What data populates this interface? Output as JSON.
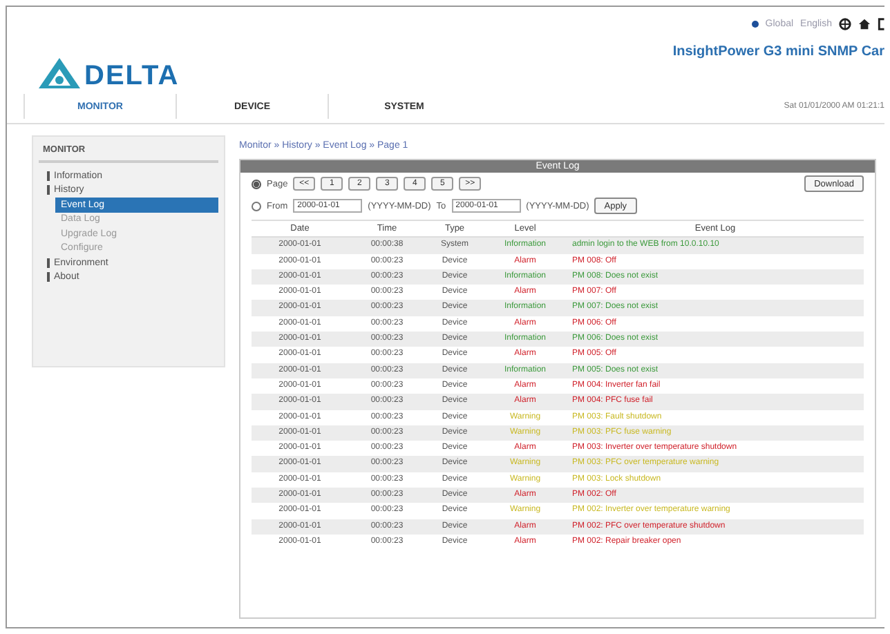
{
  "header": {
    "logo_text": "DELTA",
    "region": "Global",
    "language": "English",
    "product": "InsightPower G3 mini SNMP Car",
    "datetime": "Sat 01/01/2000 AM 01:21:1"
  },
  "nav": [
    {
      "label": "MONITOR",
      "selected": true
    },
    {
      "label": "DEVICE",
      "selected": false
    },
    {
      "label": "SYSTEM",
      "selected": false
    }
  ],
  "sidebar": {
    "title": "MONITOR",
    "items": [
      {
        "label": "Information",
        "selected": false
      },
      {
        "label": "History",
        "selected": false,
        "children": [
          {
            "label": "Event Log",
            "selected": true
          },
          {
            "label": "Data Log",
            "selected": false
          },
          {
            "label": "Upgrade Log",
            "selected": false
          },
          {
            "label": "Configure",
            "selected": false
          }
        ]
      },
      {
        "label": "Environment",
        "selected": false
      },
      {
        "label": "About",
        "selected": false
      }
    ]
  },
  "breadcrumb": "Monitor » History » Event Log » Page 1",
  "panel": {
    "title": "Event Log",
    "page_label": "Page",
    "page_selected": true,
    "range_selected": false,
    "pages": [
      "<<",
      "1",
      "2",
      "3",
      "4",
      "5",
      ">>"
    ],
    "download": "Download",
    "from_label": "From",
    "from_value": "2000-01-01",
    "from_hint": "(YYYY-MM-DD)",
    "to_label": "To",
    "to_value": "2000-01-01",
    "to_hint": "(YYYY-MM-DD)",
    "apply": "Apply"
  },
  "table": {
    "columns": [
      "Date",
      "Time",
      "Type",
      "Level",
      "Event Log"
    ],
    "rows": [
      {
        "date": "2000-01-01",
        "time": "00:00:38",
        "type": "System",
        "level": "Information",
        "event": "admin login to the WEB from 10.0.10.10",
        "color": "#3c9a3c"
      },
      {
        "date": "2000-01-01",
        "time": "00:00:23",
        "type": "Device",
        "level": "Alarm",
        "event": "PM 008: Off",
        "color": "#d0202a"
      },
      {
        "date": "2000-01-01",
        "time": "00:00:23",
        "type": "Device",
        "level": "Information",
        "event": "PM 008: Does not exist",
        "color": "#3c9a3c"
      },
      {
        "date": "2000-01-01",
        "time": "00:00:23",
        "type": "Device",
        "level": "Alarm",
        "event": "PM 007: Off",
        "color": "#d0202a"
      },
      {
        "date": "2000-01-01",
        "time": "00:00:23",
        "type": "Device",
        "level": "Information",
        "event": "PM 007: Does not exist",
        "color": "#3c9a3c"
      },
      {
        "date": "2000-01-01",
        "time": "00:00:23",
        "type": "Device",
        "level": "Alarm",
        "event": "PM 006: Off",
        "color": "#d0202a"
      },
      {
        "date": "2000-01-01",
        "time": "00:00:23",
        "type": "Device",
        "level": "Information",
        "event": "PM 006: Does not exist",
        "color": "#3c9a3c"
      },
      {
        "date": "2000-01-01",
        "time": "00:00:23",
        "type": "Device",
        "level": "Alarm",
        "event": "PM 005: Off",
        "color": "#d0202a"
      },
      {
        "date": "2000-01-01",
        "time": "00:00:23",
        "type": "Device",
        "level": "Information",
        "event": "PM 005: Does not exist",
        "color": "#3c9a3c"
      },
      {
        "date": "2000-01-01",
        "time": "00:00:23",
        "type": "Device",
        "level": "Alarm",
        "event": "PM 004: Inverter fan fail",
        "color": "#d0202a"
      },
      {
        "date": "2000-01-01",
        "time": "00:00:23",
        "type": "Device",
        "level": "Alarm",
        "event": "PM 004: PFC fuse fail",
        "color": "#d0202a"
      },
      {
        "date": "2000-01-01",
        "time": "00:00:23",
        "type": "Device",
        "level": "Warning",
        "event": "PM 003: Fault shutdown",
        "color": "#c8b820"
      },
      {
        "date": "2000-01-01",
        "time": "00:00:23",
        "type": "Device",
        "level": "Warning",
        "event": "PM 003: PFC fuse warning",
        "color": "#c8b820"
      },
      {
        "date": "2000-01-01",
        "time": "00:00:23",
        "type": "Device",
        "level": "Alarm",
        "event": "PM 003: Inverter over temperature shutdown",
        "color": "#d0202a"
      },
      {
        "date": "2000-01-01",
        "time": "00:00:23",
        "type": "Device",
        "level": "Warning",
        "event": "PM 003: PFC over temperature warning",
        "color": "#c8b820"
      },
      {
        "date": "2000-01-01",
        "time": "00:00:23",
        "type": "Device",
        "level": "Warning",
        "event": "PM 003: Lock shutdown",
        "color": "#c8b820"
      },
      {
        "date": "2000-01-01",
        "time": "00:00:23",
        "type": "Device",
        "level": "Alarm",
        "event": "PM 002: Off",
        "color": "#d0202a"
      },
      {
        "date": "2000-01-01",
        "time": "00:00:23",
        "type": "Device",
        "level": "Warning",
        "event": "PM 002: Inverter over temperature warning",
        "color": "#c8b820"
      },
      {
        "date": "2000-01-01",
        "time": "00:00:23",
        "type": "Device",
        "level": "Alarm",
        "event": "PM 002: PFC over temperature shutdown",
        "color": "#d0202a"
      },
      {
        "date": "2000-01-01",
        "time": "00:00:23",
        "type": "Device",
        "level": "Alarm",
        "event": "PM 002: Repair breaker open",
        "color": "#d0202a"
      }
    ]
  }
}
